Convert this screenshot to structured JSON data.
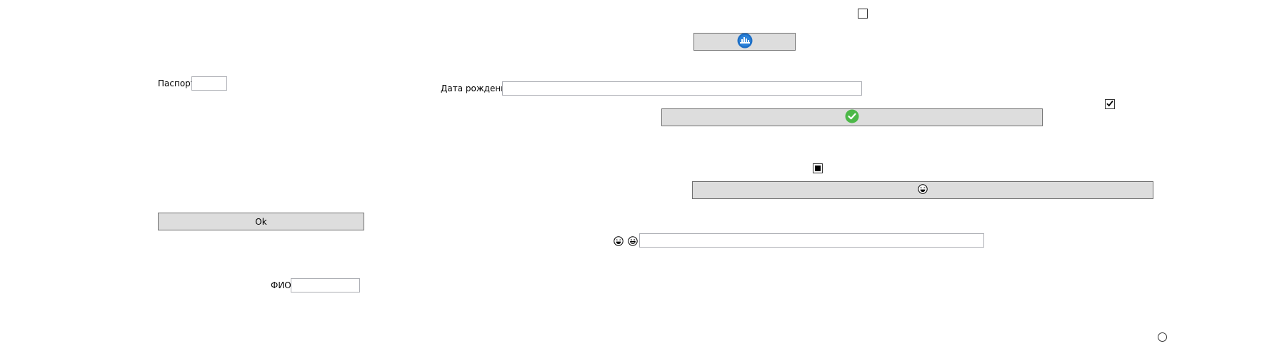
{
  "form": {
    "passport_label": "Паспорт",
    "passport_value": "",
    "birthdate_label": "Дата рождения",
    "birthdate_value": "",
    "fio_label": "ФИО",
    "fio_value": "",
    "ok_button_label": "Ok",
    "emoji_field_value": ""
  },
  "checkboxes": {
    "top_checked": false,
    "right_checked": true,
    "middle_state": "indeterminate"
  },
  "radio": {
    "bottom_right_selected": false
  },
  "colors": {
    "button_bg": "#dddddd",
    "button_border": "#707070",
    "textbox_border": "#abadb3",
    "success_green": "#4cb848",
    "brand_blue": "#1e6fc6"
  },
  "icons": {
    "top_button_icon": "blue-round-logo-icon",
    "wide_button_icon": "green-checkmark-icon",
    "bottom_button_icon": "smiley-face-icon",
    "emoji_a": "laughing-face-icon",
    "emoji_b": "grinning-face-icon"
  }
}
